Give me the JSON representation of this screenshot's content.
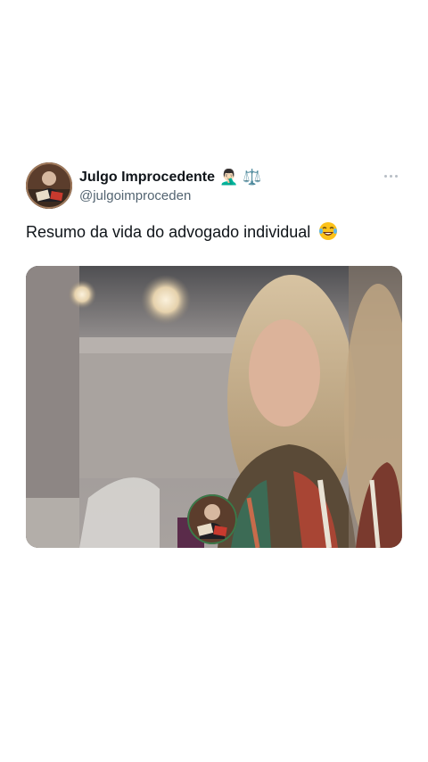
{
  "tweet": {
    "display_name": "Julgo Improcedente",
    "name_emojis": [
      "🤦🏻‍♂️",
      "⚖️"
    ],
    "handle": "@julgoimproceden",
    "text": "Resumo da vida do advogado individual",
    "text_emoji": "laughing-with-tears",
    "more_icon": "more-horizontal-icon"
  },
  "media": {
    "type": "video-still",
    "description_icon": "profile-watermark-icon"
  },
  "colors": {
    "background": "#ffffff",
    "name": "#0f1419",
    "handle": "#536471",
    "more_dots": "#b7bec5"
  }
}
